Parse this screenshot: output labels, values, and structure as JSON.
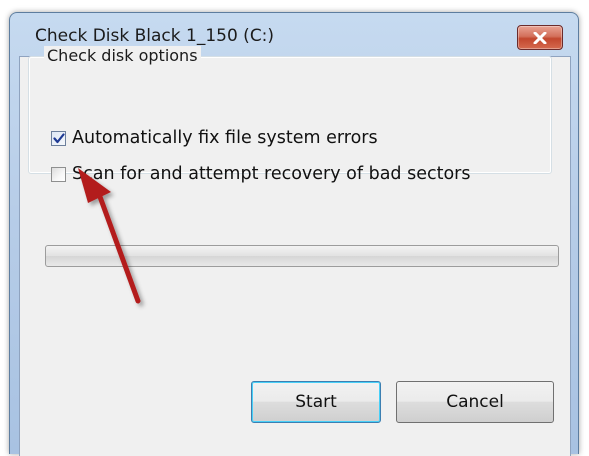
{
  "dialog": {
    "title": "Check Disk Black 1_150 (C:)",
    "close_icon": "close-x-icon"
  },
  "options": {
    "group_label": "Check disk options",
    "items": [
      {
        "label": "Automatically fix file system errors",
        "checked": true
      },
      {
        "label": "Scan for and attempt recovery of bad sectors",
        "checked": false
      }
    ]
  },
  "progress": {
    "value": 0
  },
  "buttons": {
    "start_label": "Start",
    "cancel_label": "Cancel"
  },
  "annotation": {
    "icon": "red-arrow-annotation",
    "color": "#b31d1d"
  }
}
